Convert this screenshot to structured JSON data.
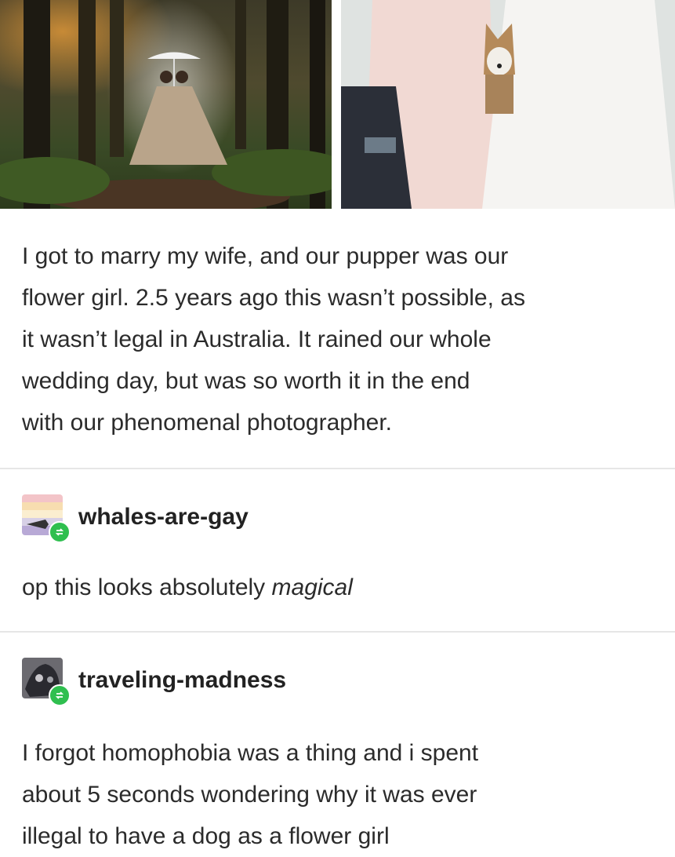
{
  "photos": {
    "left_alt": "couple under umbrella in forest",
    "right_alt": "two wedding dresses with husky dog"
  },
  "post": {
    "lines": [
      "I got to marry my wife, and our pupper was our",
      "flower girl. 2.5 years ago this wasn’t possible, as",
      "it wasn’t legal in Australia. It rained our whole",
      "wedding day, but was so worth it in the end",
      "with our phenomenal photographer."
    ]
  },
  "reblogs": [
    {
      "username": "whales-are-gay",
      "text_plain": "op this looks absolutely ",
      "text_emph": "magical"
    },
    {
      "username": "traveling-madness",
      "lines": [
        "I forgot homophobia was a thing and i spent",
        "about 5 seconds wondering why it was ever",
        "illegal to have a dog as a flower girl"
      ]
    }
  ],
  "colors": {
    "reblog_badge": "#2fbf4f",
    "divider": "#e6e6e6"
  }
}
